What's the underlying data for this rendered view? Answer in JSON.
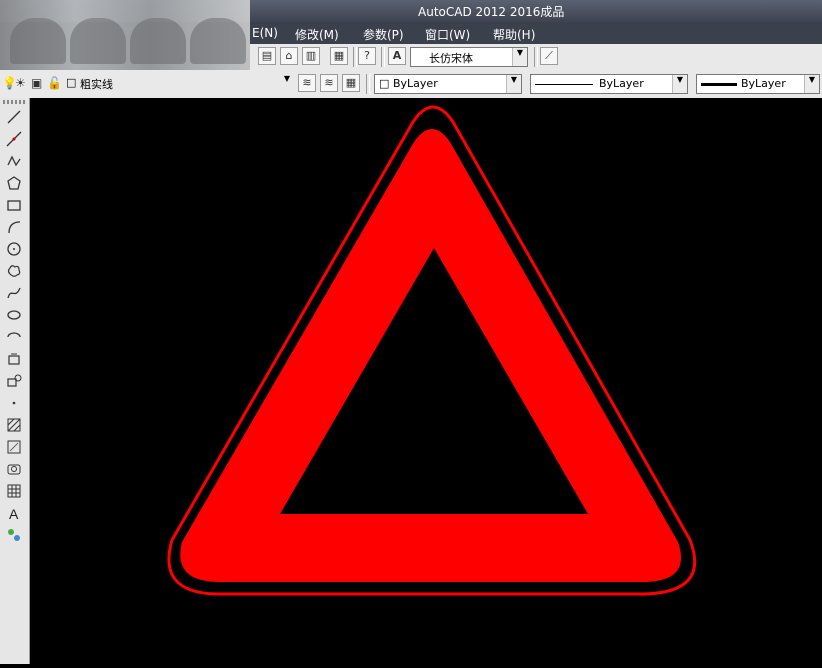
{
  "app": {
    "title": "AutoCAD 2012     2016成品"
  },
  "menu": {
    "items": [
      "E(N)",
      "修改(M)",
      "参数(P)",
      "窗口(W)",
      "帮助(H)"
    ]
  },
  "text_style": {
    "font": "长仿宋体"
  },
  "layer": {
    "name": "粗实线"
  },
  "properties": {
    "color": "ByLayer",
    "linetype": "ByLayer",
    "lineweight": "ByLayer"
  },
  "colors": {
    "shape_fill": "#ff0000",
    "canvas": "#000000"
  },
  "left_tools": [
    "line-icon",
    "construction-line-icon",
    "polyline-icon",
    "polygon-icon",
    "rectangle-icon",
    "arc-icon",
    "circle-icon",
    "revision-cloud-icon",
    "spline-icon",
    "ellipse-icon",
    "ellipse-arc-icon",
    "insert-block-icon",
    "make-block-icon",
    "point-icon",
    "hatch-icon",
    "gradient-icon",
    "region-icon",
    "table-icon",
    "multiline-text-icon",
    "add-selected-icon"
  ]
}
